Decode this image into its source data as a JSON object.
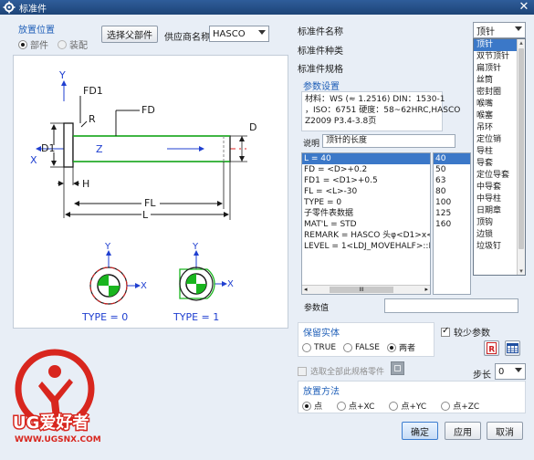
{
  "window": {
    "title": "标准件",
    "close_glyph": "✕"
  },
  "placement": {
    "title": "放置位置",
    "options": [
      {
        "label": "部件",
        "selected": true
      },
      {
        "label": "装配",
        "selected": false
      }
    ],
    "select_parent_button": "选择父部件",
    "supplier_label": "供应商名称",
    "supplier_value": "HASCO"
  },
  "drawing": {
    "dim_labels": {
      "y_top": "Y",
      "fd1": "FD1",
      "r": "R",
      "fd": "FD",
      "d": "D",
      "d1": "D1",
      "z": "Z",
      "x_left": "X",
      "h": "H",
      "fl": "FL",
      "l": "L"
    },
    "type_views": [
      {
        "label": "TYPE = 0",
        "axis_y": "Y",
        "axis_x": "X"
      },
      {
        "label": "TYPE = 1",
        "axis_y": "Y",
        "axis_x": "X"
      }
    ]
  },
  "right": {
    "name_label": "标准件名称",
    "category_label": "标准件种类",
    "spec_label": "标准件规格",
    "name_value": "顶针",
    "name_options": [
      "顶针",
      "双节顶针",
      "扁顶针",
      "丝筒",
      "密封圈",
      "喉嘴",
      "喉塞",
      "吊环",
      "定位销",
      "导柱",
      "导套",
      "定位导套",
      "中导套",
      "中导柱",
      "日期章",
      "顶钩",
      "边锁",
      "垃圾钉"
    ],
    "param_title": "参数设置",
    "material_lines": [
      "材料：WS (≈ 1.2516) DIN：1530-1",
      "，ISO：6751 硬度：58~62HRC,HASCO",
      "Z2009 P3.4-3.8页"
    ],
    "desc_label": "说明",
    "desc_value": "顶针的长度",
    "params": [
      "L = 40",
      "FD = <D>+0.2",
      "FD1 = <D1>+0.5",
      "FL = <L>-30",
      "TYPE = 0",
      "子零件表数据",
      "MAT'L = STD",
      "REMARK = HASCO 头φ<D1>x<",
      "LEVEL = 1<LDJ_MOVEHALF>::E"
    ],
    "values": [
      "40",
      "50",
      "63",
      "80",
      "100",
      "125",
      "160"
    ],
    "hscroll_marker": "III",
    "param_value_label": "参数值",
    "param_value": ""
  },
  "keep_solid": {
    "title": "保留实体",
    "options": [
      {
        "label": "TRUE",
        "selected": false
      },
      {
        "label": "FALSE",
        "selected": false
      },
      {
        "label": "两者",
        "selected": true
      }
    ]
  },
  "fewer_params": {
    "label": "较少参数",
    "checked": true
  },
  "select_all": {
    "label": "选取全部此规格零件",
    "checked": false
  },
  "step": {
    "label": "步长",
    "value": "0"
  },
  "method": {
    "title": "放置方法",
    "options": [
      {
        "label": "点",
        "selected": true
      },
      {
        "label": "点+XC",
        "selected": false
      },
      {
        "label": "点+YC",
        "selected": false
      },
      {
        "label": "点+ZC",
        "selected": false
      }
    ]
  },
  "buttons": {
    "ok": "确定",
    "apply": "应用",
    "cancel": "取消"
  },
  "logo": {
    "brand": "UG爱好者",
    "url": "WWW.UGSNX.COM"
  },
  "colors": {
    "title_bar": "#1d4477",
    "accent": "#1f5fb8",
    "selection": "#3b78c8",
    "green": "#19b51e",
    "red": "#e02020",
    "logo_red": "#d8261e"
  }
}
